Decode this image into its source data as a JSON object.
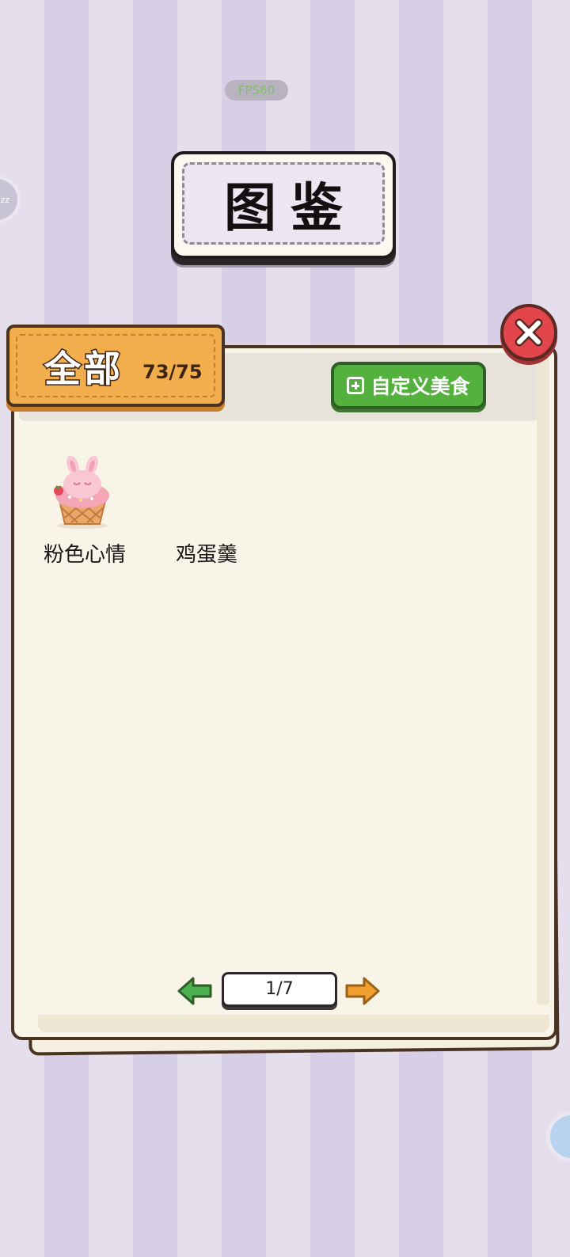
{
  "fps": "FPS60",
  "left_bubble_text": "zz",
  "title": "图鉴",
  "tab": {
    "name": "全部",
    "count": "73/75"
  },
  "custom_button": "自定义美食",
  "items": [
    {
      "name": "粉色心情",
      "icon": "bunny-cupcake-icon"
    },
    {
      "name": "鸡蛋羹",
      "icon": "none"
    }
  ],
  "pager": {
    "page": "1/7"
  },
  "colors": {
    "tab": "#f2ad4c",
    "custom_button": "#54b13e",
    "close_button": "#e2464c",
    "prev_arrow": "#4caf50",
    "next_arrow": "#f0a030"
  }
}
